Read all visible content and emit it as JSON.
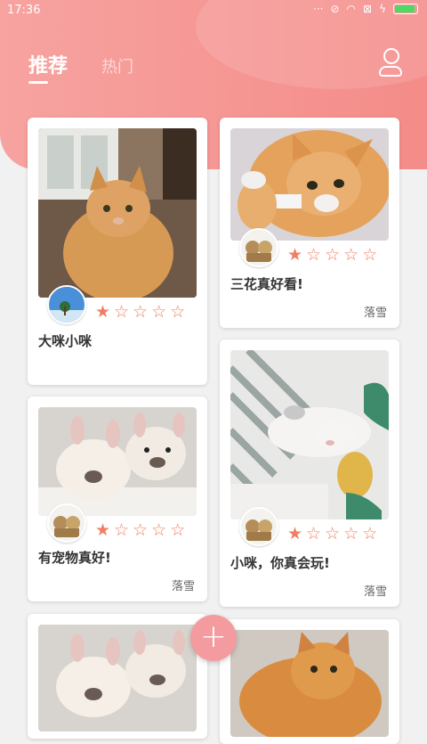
{
  "status_bar": {
    "time": "17:36",
    "icons": [
      "signal-dots-icon",
      "alarm-icon",
      "wifi-icon",
      "sim-icon",
      "charging-icon",
      "battery-icon"
    ]
  },
  "tabs": [
    {
      "label": "推荐",
      "selected": true
    },
    {
      "label": "热门",
      "selected": false
    }
  ],
  "header": {
    "profile_icon": "user-icon"
  },
  "posts": [
    {
      "title": "大咪小咪",
      "author": "",
      "rating": 1,
      "max_rating": 5,
      "image": "orange-cat-window",
      "avatar": "blue-sky-avatar"
    },
    {
      "title": "三花真好看!",
      "author": "落雪",
      "rating": 1,
      "max_rating": 5,
      "image": "orange-cat-lying",
      "avatar": "teddy-bears-avatar"
    },
    {
      "title": "小咪，你真会玩!",
      "author": "落雪",
      "rating": 1,
      "max_rating": 5,
      "image": "white-cat-sleeping",
      "avatar": "teddy-bears-avatar"
    },
    {
      "title": "有宠物真好!",
      "author": "落雪",
      "rating": 1,
      "max_rating": 5,
      "image": "french-bulldog-puppies",
      "avatar": "teddy-bears-avatar"
    },
    {
      "title": "",
      "author": "",
      "rating": 0,
      "max_rating": 5,
      "image": "french-bulldog-puppies",
      "avatar": ""
    },
    {
      "title": "",
      "author": "",
      "rating": 0,
      "max_rating": 5,
      "image": "orange-cat-portrait",
      "avatar": ""
    }
  ],
  "fab": {
    "label": "+"
  },
  "colors": {
    "accent": "#f48c89",
    "star": "#f07e63",
    "fab": "#f49ba0"
  }
}
